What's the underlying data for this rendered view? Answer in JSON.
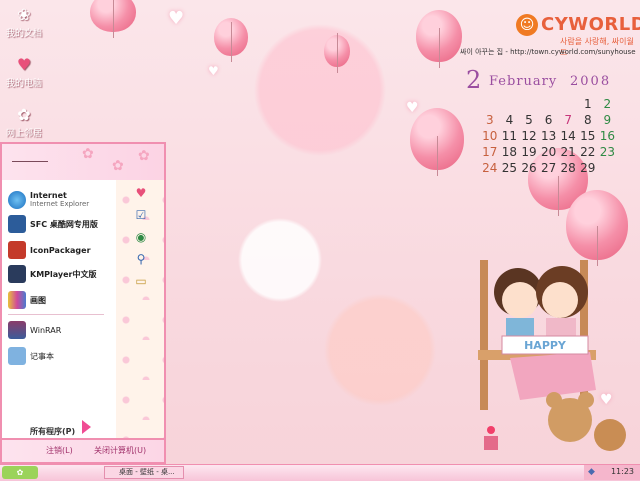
{
  "desktop_icons": [
    {
      "label": "我的文档",
      "icon": "folder-icon"
    },
    {
      "label": "我的电脑",
      "icon": "computer-icon"
    },
    {
      "label": "网上邻居",
      "icon": "network-icon"
    }
  ],
  "start_menu": {
    "items": [
      {
        "title": "Internet",
        "subtitle": "Internet Explorer",
        "icon": "ie-icon"
      },
      {
        "title": "SFC 桌酷网专用版",
        "subtitle": "",
        "icon": "sfc-icon"
      },
      {
        "title": "IconPackager",
        "subtitle": "",
        "icon": "iconpackager-icon"
      },
      {
        "title": "KMPlayer中文版",
        "subtitle": "",
        "icon": "kmplayer-icon"
      },
      {
        "title": "画图",
        "subtitle": "",
        "icon": "paint-icon"
      },
      {
        "title": "WinRAR",
        "subtitle": "",
        "icon": "winrar-icon"
      },
      {
        "title": "记事本",
        "subtitle": "",
        "icon": "notepad-icon"
      }
    ],
    "all_programs": "所有程序(P)",
    "logoff": "注销(L)",
    "shutdown": "关闭计算机(U)",
    "right_icons": [
      "heart-icon",
      "checklist-icon",
      "globe-icon",
      "search-icon",
      "folder-icon"
    ]
  },
  "taskbar": {
    "task_label": "桌面 - 壁纸 - 桌...",
    "clock": "11:23"
  },
  "wallpaper": {
    "brand": "CYWORLD",
    "slogan": "사람을 사랑해, 싸이월드",
    "url_line": "싸이 아꾸는 집 - http://town.cyworld.com/sunyhouse",
    "calendar": {
      "month_num": "2",
      "month": "February",
      "year": "2008",
      "rows": [
        [
          "",
          "",
          "",
          "",
          "",
          "1",
          "2"
        ],
        [
          "3",
          "4",
          "5",
          "6",
          "7",
          "8",
          "9"
        ],
        [
          "10",
          "11",
          "12",
          "13",
          "14",
          "15",
          "16"
        ],
        [
          "17",
          "18",
          "19",
          "20",
          "21",
          "22",
          "23"
        ],
        [
          "24",
          "25",
          "26",
          "27",
          "28",
          "29",
          ""
        ]
      ]
    },
    "sign_text": "HAPPY"
  },
  "colors": {
    "accent": "#f08fb0",
    "calendar": "#9a4ea0",
    "brand": "#e8603c"
  }
}
